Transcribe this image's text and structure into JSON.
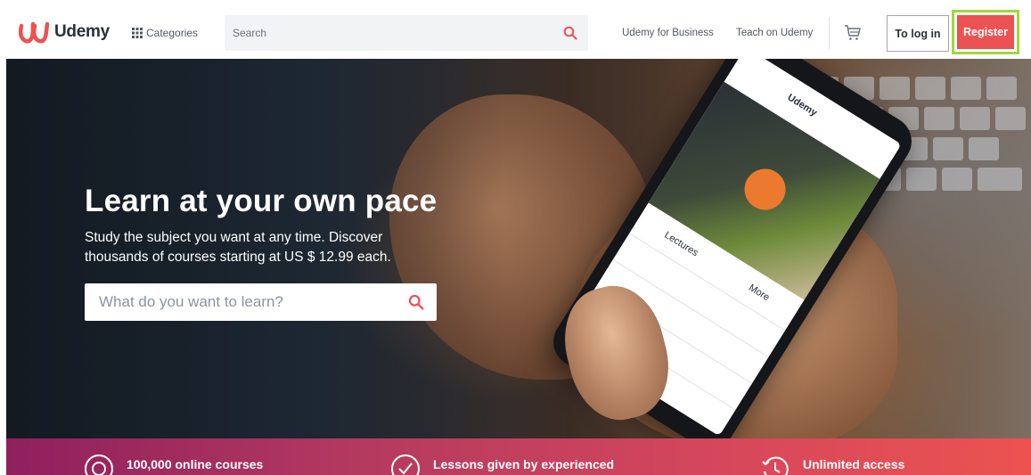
{
  "header": {
    "logo_text": "Udemy",
    "categories_label": "Categories",
    "search_placeholder": "Search",
    "nav_links": [
      "Udemy for Business",
      "Teach on Udemy"
    ],
    "login_label": "To log in",
    "register_label": "Register"
  },
  "hero": {
    "title": "Learn at your own pace",
    "subtitle": "Study the subject you want at any time. Discover thousands of courses starting at US $ 12.99 each.",
    "search_placeholder": "What do you want to learn?"
  },
  "features": [
    {
      "icon": "target-icon",
      "text": "100,000 online courses"
    },
    {
      "icon": "checkmark-circle-icon",
      "text": "Lessons given by experienced"
    },
    {
      "icon": "history-clock-icon",
      "text": "Unlimited access"
    }
  ],
  "colors": {
    "brand_red": "#ec5252",
    "highlight_green": "#a4d63c",
    "text_dark": "#29303b"
  }
}
